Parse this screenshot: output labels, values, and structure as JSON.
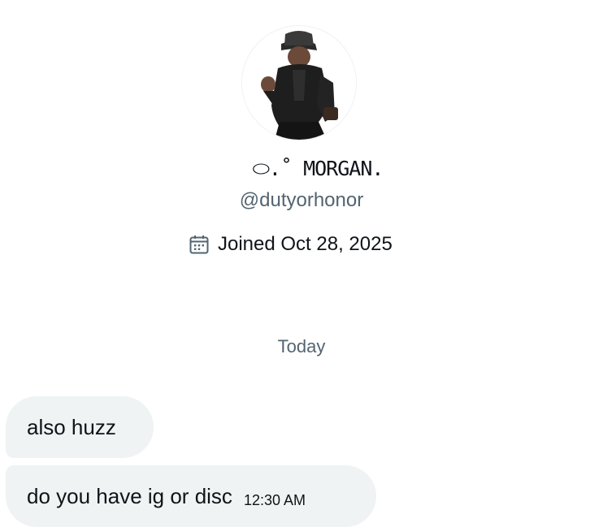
{
  "profile": {
    "avatar_icon": "profile-photo-man-in-fedora",
    "display_name": "⬭.˚ MORGAN.",
    "handle": "@dutyorhonor",
    "joined_icon": "calendar-icon",
    "joined_text": "Joined Oct 28, 2025"
  },
  "conversation": {
    "date_separator": "Today",
    "messages": [
      {
        "text": "also huzz",
        "time": ""
      },
      {
        "text": "do you have ig or disc",
        "time": "12:30 AM"
      }
    ],
    "bubble_color": "#eff3f4"
  }
}
